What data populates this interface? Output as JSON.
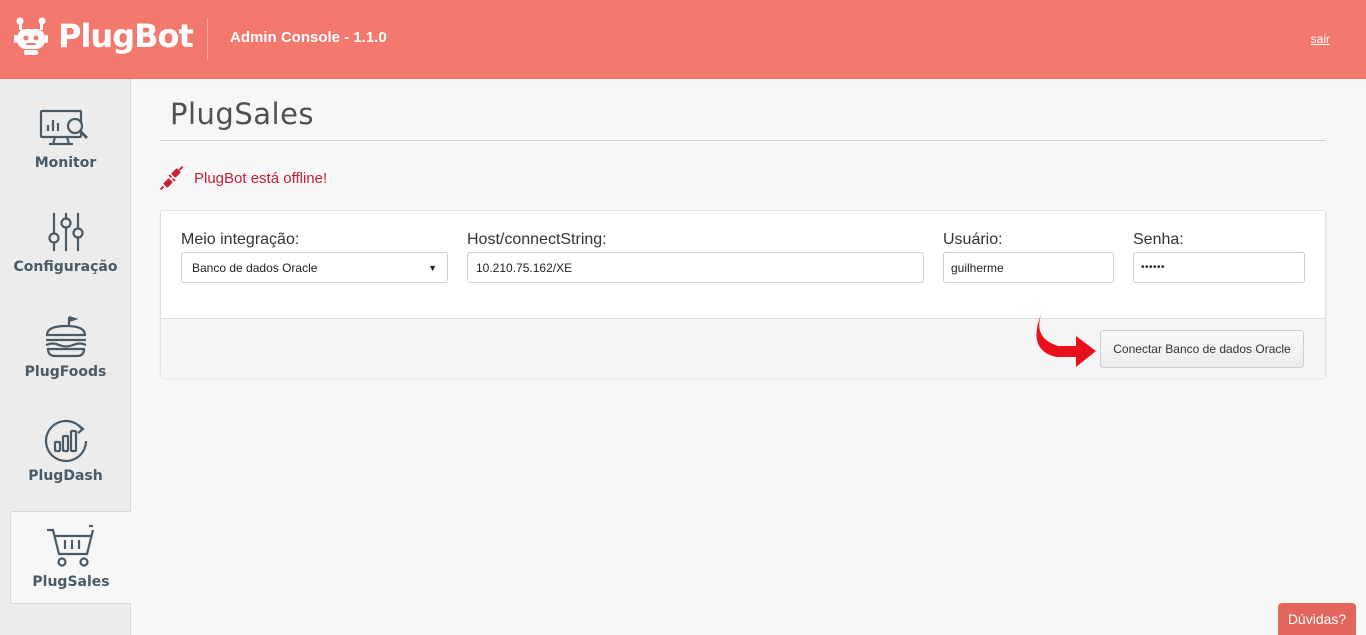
{
  "header": {
    "logo_text": "PlugBot",
    "title": "Admin Console - 1.1.0",
    "logout_label": "sair"
  },
  "sidebar": {
    "items": [
      {
        "label": "Monitor",
        "icon": "monitor-icon"
      },
      {
        "label": "Configuração",
        "icon": "sliders-icon"
      },
      {
        "label": "PlugFoods",
        "icon": "burger-icon"
      },
      {
        "label": "PlugDash",
        "icon": "chart-icon"
      },
      {
        "label": "PlugSales",
        "icon": "cart-icon",
        "active": true
      }
    ]
  },
  "main": {
    "title": "PlugSales",
    "status_text": "PlugBot está offline!",
    "form": {
      "integration_label": "Meio integração:",
      "integration_value": "Banco de dados Oracle",
      "host_label": "Host/connectString:",
      "host_value": "10.210.75.162/XE",
      "user_label": "Usuário:",
      "user_value": "guilherme",
      "password_label": "Senha:",
      "password_value": "••••••"
    },
    "connect_button": "Conectar Banco de dados Oracle"
  },
  "help_button": "Dúvidas?",
  "colors": {
    "header_bg": "#f3796e",
    "status_red": "#c41f3b",
    "sidebar_text": "#4a5a66"
  }
}
